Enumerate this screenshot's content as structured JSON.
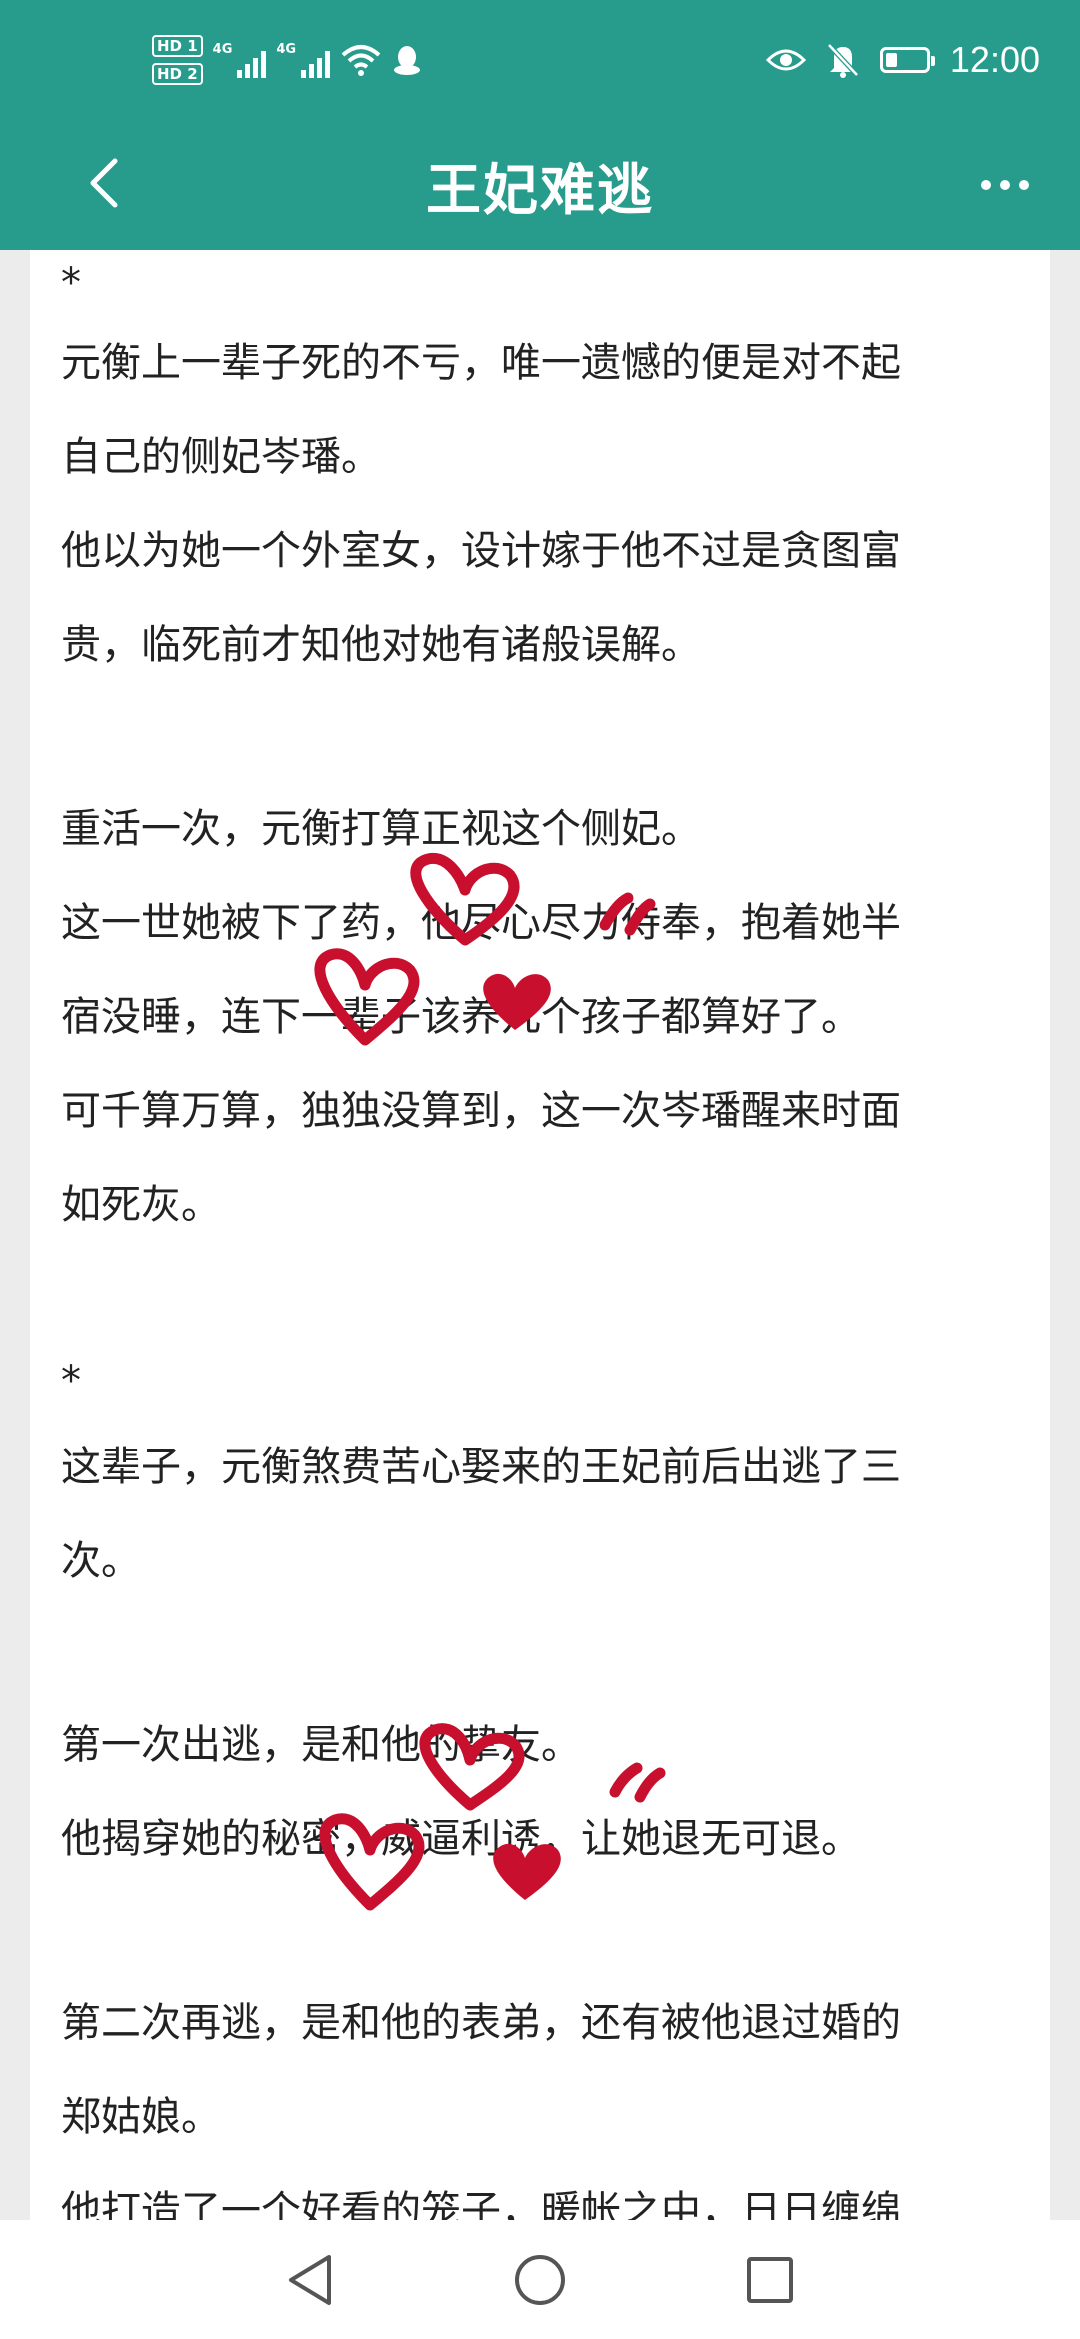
{
  "status_bar": {
    "sim1": "HD 1",
    "sim2": "HD 2",
    "network1": "4G",
    "network2": "4G",
    "time": "12:00",
    "battery_level": 0.3,
    "icons": [
      "signal-icon",
      "signal-icon",
      "wifi-icon",
      "notification-app-icon",
      "eye-icon",
      "bell-off-icon",
      "battery-icon"
    ]
  },
  "app_bar": {
    "title": "王妃难逃",
    "back_icon": "chevron-left-icon",
    "more_icon": "more-dots-icon"
  },
  "article": {
    "separator_1": "*",
    "lines_a": [
      "元衡上一辈子死的不亏，唯一遗憾的便是对不起",
      "自己的侧妃岑璠。",
      "他以为她一个外室女，设计嫁于他不过是贪图富",
      "贵，临死前才知他对她有诸般误解。"
    ],
    "lines_b": [
      "重活一次，元衡打算正视这个侧妃。",
      "这一世她被下了药，他尽心尽力侍奉，抱着她半",
      "宿没睡，连下一辈子该养几个孩子都算好了。",
      "可千算万算，独独没算到，这一次岑璠醒来时面",
      "如死灰。"
    ],
    "separator_2": "*",
    "lines_c": [
      "这辈子，元衡煞费苦心娶来的王妃前后出逃了三",
      "次。"
    ],
    "lines_d": [
      "第一次出逃，是和他的挚友。",
      "他揭穿她的秘密，威逼利诱，让她退无可退。"
    ],
    "lines_e": [
      "第二次再逃，是和他的表弟，还有被他退过婚的",
      "郑姑娘。",
      "他打造了一个好看的笼子，暖帐之中，日日缠绵"
    ]
  },
  "nav_bar": {
    "back_icon": "triangle-back-icon",
    "home_icon": "circle-home-icon",
    "recents_icon": "square-recents-icon"
  },
  "colors": {
    "accent": "#279c8c",
    "heart": "#c8102e",
    "text": "#222222"
  }
}
